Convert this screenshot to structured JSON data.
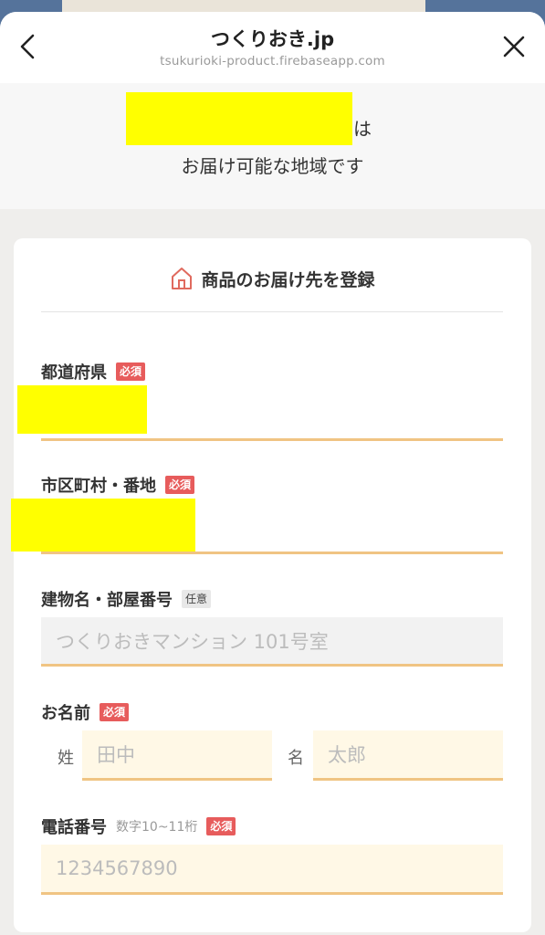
{
  "browser": {
    "title": "つくりおき.jp",
    "url": "tsukurioki-product.firebaseapp.com",
    "back_icon": "chevron-left-icon",
    "close_icon": "close-icon"
  },
  "banner": {
    "suffix": "は",
    "line2": "お届け可能な地域です"
  },
  "form": {
    "heading_icon": "home-icon",
    "heading": "商品のお届け先を登録",
    "required_badge": "必須",
    "optional_badge": "任意",
    "prefecture": {
      "label": "都道府県"
    },
    "city": {
      "label": "市区町村・番地"
    },
    "building": {
      "label": "建物名・部屋番号",
      "placeholder": "つくりおきマンション 101号室"
    },
    "name": {
      "label": "お名前",
      "last_prefix": "姓",
      "last_placeholder": "田中",
      "first_prefix": "名",
      "first_placeholder": "太郎"
    },
    "phone": {
      "label": "電話番号",
      "hint": "数字10~11桁",
      "placeholder": "1234567890"
    }
  },
  "colors": {
    "accent_underline": "#f0c483",
    "required_badge": "#e75c5c",
    "redaction": "#ffff00",
    "home_icon": "#e06a5e"
  }
}
